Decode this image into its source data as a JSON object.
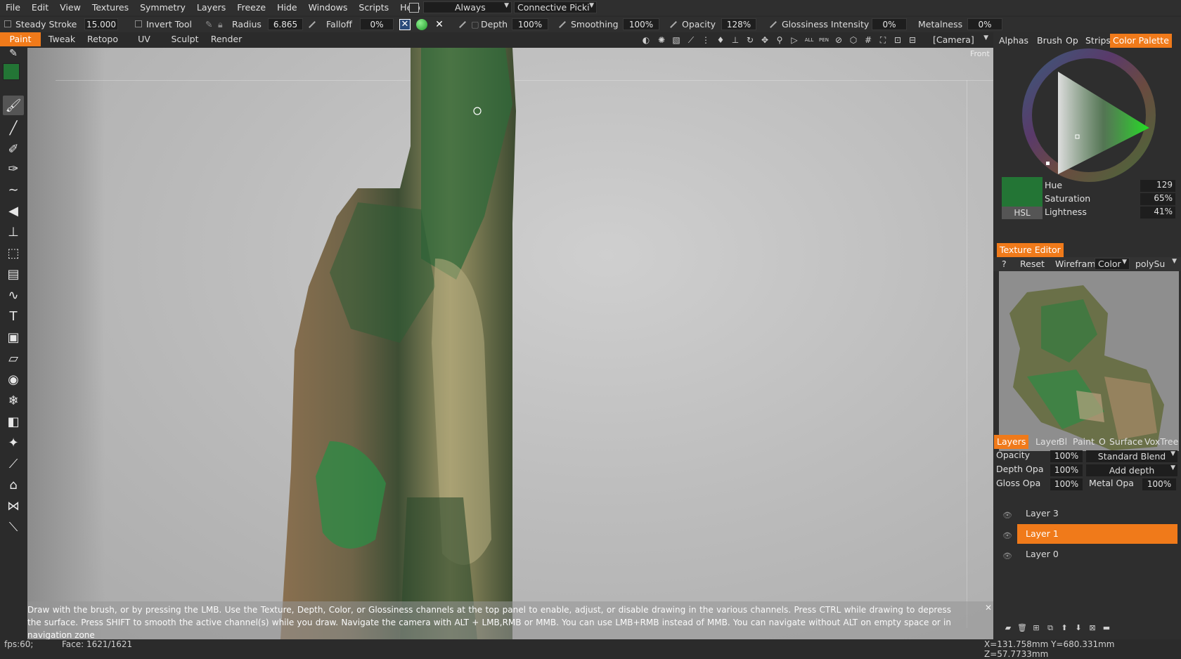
{
  "menubar": {
    "items": [
      "File",
      "Edit",
      "View",
      "Textures",
      "Symmetry",
      "Layers",
      "Freeze",
      "Hide",
      "Windows",
      "Scripts",
      "Help"
    ],
    "pick_mode": "Always",
    "pick_type": "Connective Picki"
  },
  "toolbar": {
    "steady_stroke_label": "Steady Stroke",
    "steady_stroke_value": "15.000",
    "invert_tool_label": "Invert Tool",
    "radius_label": "Radius",
    "radius_value": "6.865",
    "falloff_label": "Falloff",
    "falloff_value": "0%",
    "depth_label": "Depth",
    "depth_value": "100%",
    "smoothing_label": "Smoothing",
    "smoothing_value": "100%",
    "opacity_label": "Opacity",
    "opacity_value": "128%",
    "glossiness_label": "Glossiness Intensity",
    "glossiness_value": "0%",
    "metalness_label": "Metalness",
    "metalness_value": "0%"
  },
  "modes": {
    "tabs": [
      "Paint",
      "Tweak",
      "Retopo",
      "UV",
      "Sculpt",
      "Render"
    ],
    "active": "Paint",
    "camera": "[Camera]"
  },
  "viewport": {
    "view_label": "Front",
    "hint": "Draw with the brush, or by pressing the LMB. Use the Texture, Depth, Color, or Glossiness channels at the top panel to enable, adjust, or disable drawing in the various channels. Press CTRL while drawing to depress the surface. Press SHIFT to smooth the active channel(s) while you draw. Navigate the camera with ALT + LMB,RMB or MMB. You can use LMB+RMB instead of MMB. You can navigate without ALT on empty space or in navigation zone"
  },
  "status": {
    "fps": "fps:60;",
    "face": "Face: 1621/1621",
    "coords": "X=131.758mm  Y=680.331mm  Z=57.7733mm"
  },
  "right_panel": {
    "top_tabs": [
      "Alphas",
      "Brush",
      "Op",
      "Strips",
      "Color Palette"
    ],
    "active_top_tab": "Color Palette",
    "hue_label": "Hue",
    "hue_value": "129",
    "saturation_label": "Saturation",
    "saturation_value": "65%",
    "lightness_label": "Lightness",
    "lightness_value": "41%",
    "hsl_button": "HSL",
    "current_color": "#237535",
    "texture_editor_title": "Texture Editor",
    "te_help": "?",
    "te_reset": "Reset",
    "te_wireframe": "Wirefram",
    "te_channel": "Color",
    "te_object": "polySu",
    "layer_tabs": [
      "Layers",
      "Layer",
      "Bl",
      "Paint",
      "O",
      "Surface",
      "VoxTree"
    ],
    "active_layer_tab": "Layers",
    "layer_opacity_label": "Opacity",
    "layer_opacity_value": "100%",
    "blend_mode": "Standard Blend",
    "depth_opacity_label": "Depth Opa",
    "depth_opacity_value": "100%",
    "depth_mode": "Add depth",
    "gloss_opacity_label": "Gloss Opa",
    "gloss_opacity_value": "100%",
    "metal_opacity_label": "Metal Opa",
    "metal_opacity_value": "100%",
    "layers": [
      "Layer 3",
      "Layer 1",
      "Layer 0"
    ],
    "active_layer": "Layer 1"
  },
  "colors": {
    "accent": "#f07a1a",
    "primary_color": "#237535",
    "secondary_color": "#8a4a20"
  }
}
